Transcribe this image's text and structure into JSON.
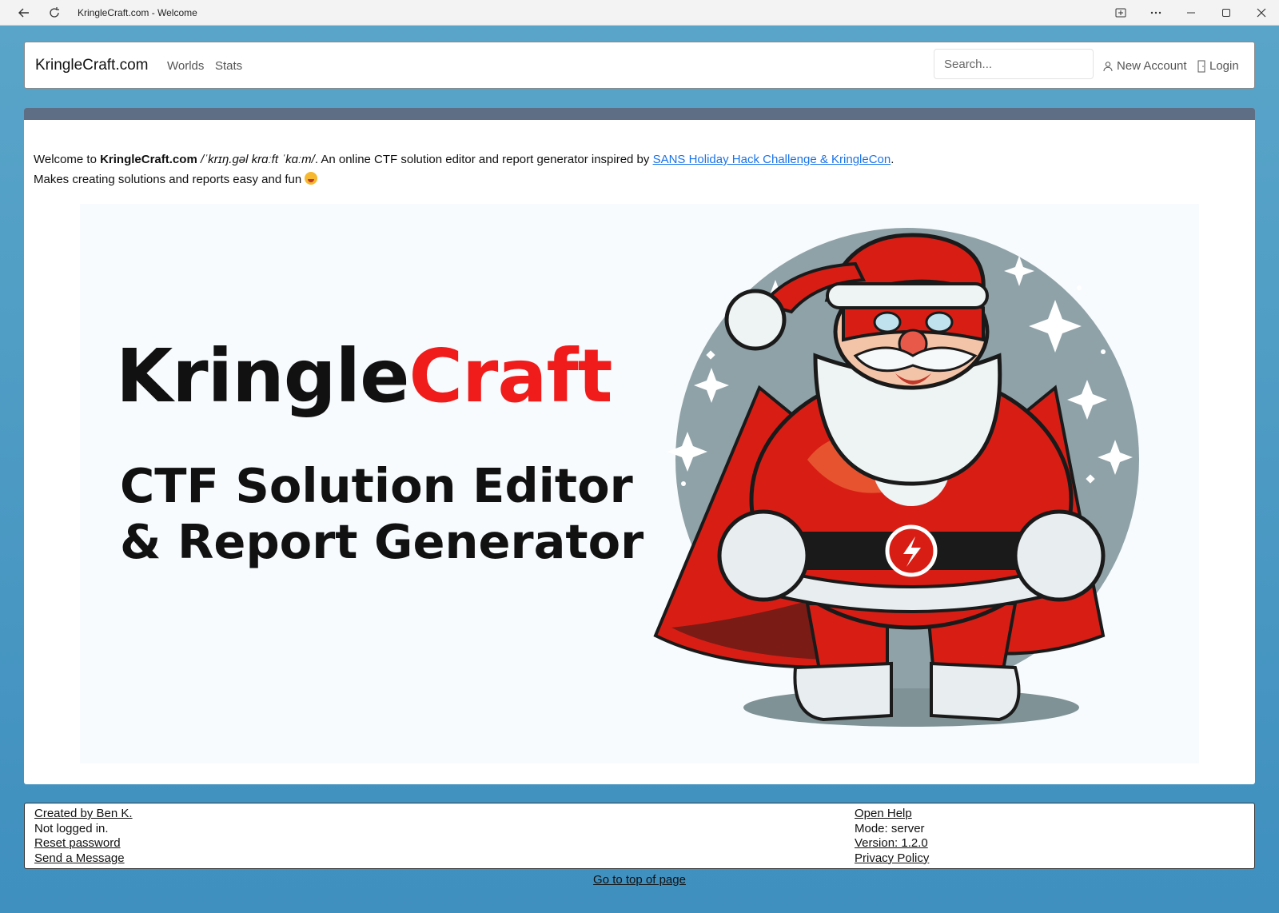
{
  "window": {
    "title": "KringleCraft.com - Welcome"
  },
  "navbar": {
    "brand": "KringleCraft.com",
    "links": [
      "Worlds",
      "Stats"
    ],
    "search_placeholder": "Search...",
    "new_account": "New Account",
    "login": "Login"
  },
  "intro": {
    "welcome_prefix": "Welcome to ",
    "site_name": "KringleCraft.com",
    "pronunciation": " /ˈkrɪŋ.ɡəl krɑːft ˈkɑːm/",
    "description": ". An online CTF solution editor and report generator inspired by ",
    "link_text": "SANS Holiday Hack Challenge & KringleCon",
    "line_end": ".",
    "line2": "Makes creating solutions and reports easy and fun "
  },
  "hero": {
    "title_black": "Kringle",
    "title_red": "Craft",
    "subtitle_line1": "CTF Solution Editor",
    "subtitle_line2": "& Report Generator"
  },
  "footer": {
    "left": {
      "created_by": "Created by Ben K.",
      "status": "Not logged in.",
      "reset_password": "Reset password",
      "send_message": "Send a Message"
    },
    "right": {
      "open_help": "Open Help",
      "mode": "Mode: server",
      "version": "Version: 1.2.0",
      "privacy": "Privacy Policy"
    },
    "go_top": "Go to top of page"
  },
  "colors": {
    "accent_red": "#f01c1c",
    "link_blue": "#1a73e8",
    "card_header": "#5e6e85",
    "background": "#4f9dc5"
  }
}
